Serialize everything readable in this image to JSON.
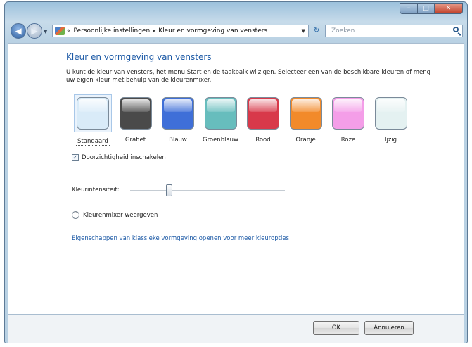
{
  "window": {
    "controls": {
      "minimize": "–",
      "maximize": "□",
      "close": "✕"
    }
  },
  "navigation": {
    "breadcrumb_prefix": "«",
    "breadcrumb": [
      "Persoonlijke instellingen",
      "Kleur en vormgeving van vensters"
    ],
    "breadcrumb_separator": "▸",
    "search_placeholder": "Zoeken"
  },
  "page": {
    "title": "Kleur en vormgeving van vensters",
    "description": "U kunt de kleur van vensters, het menu Start en de taakbalk wijzigen. Selecteer een van de beschikbare kleuren of meng uw eigen kleur met behulp van de kleurenmixer."
  },
  "swatches": [
    {
      "label": "Standaard",
      "color": "#d9ebf8",
      "selected": true
    },
    {
      "label": "Grafiet",
      "color": "#4a4a4a",
      "selected": false
    },
    {
      "label": "Blauw",
      "color": "#3f6fd8",
      "selected": false
    },
    {
      "label": "Groenblauw",
      "color": "#67bdbd",
      "selected": false
    },
    {
      "label": "Rood",
      "color": "#d8394a",
      "selected": false
    },
    {
      "label": "Oranje",
      "color": "#f28a2a",
      "selected": false
    },
    {
      "label": "Roze",
      "color": "#f49ee8",
      "selected": false
    },
    {
      "label": "Ijzig",
      "color": "#e4f1f1",
      "selected": false
    }
  ],
  "transparency": {
    "label": "Doorzichtigheid inschakelen",
    "checked": true
  },
  "intensity": {
    "label": "Kleurintensiteit:",
    "value": 0.25
  },
  "mixer": {
    "label": "Kleurenmixer weergeven"
  },
  "classic_link": "Eigenschappen van klassieke vormgeving openen voor meer kleuropties",
  "buttons": {
    "ok": "OK",
    "cancel": "Annuleren"
  }
}
